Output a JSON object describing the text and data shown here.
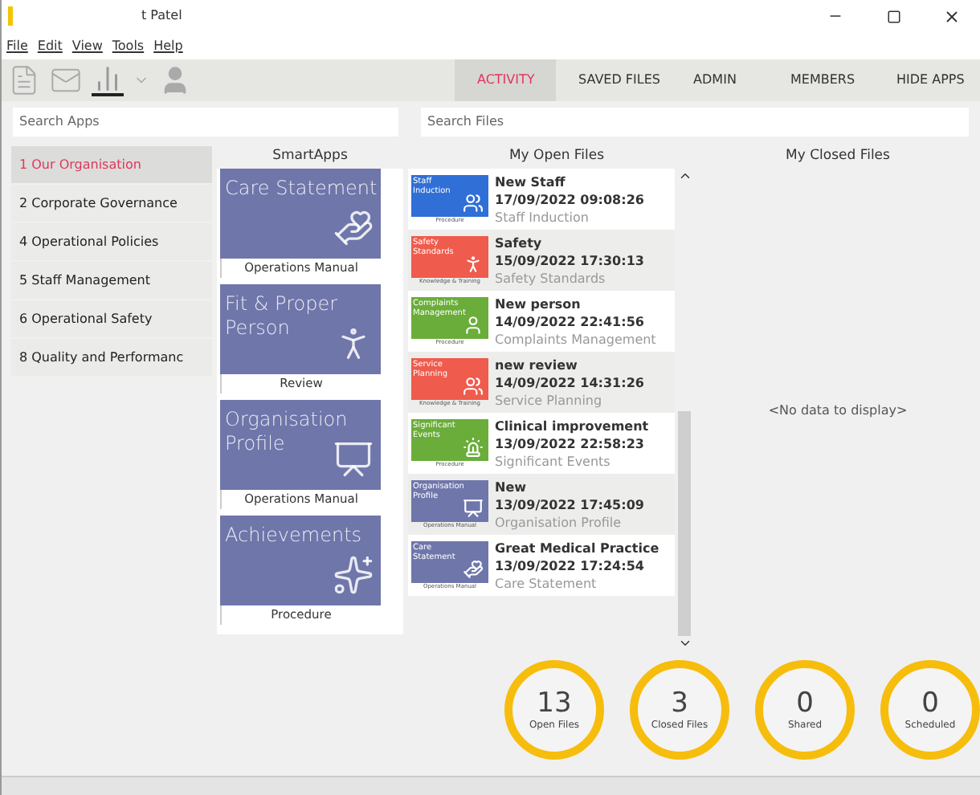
{
  "window": {
    "title": "t Patel"
  },
  "menu": [
    "File",
    "Edit",
    "View",
    "Tools",
    "Help"
  ],
  "tabs": [
    {
      "label": "ACTIVITY",
      "selected": true
    },
    {
      "label": "SAVED FILES",
      "selected": false
    },
    {
      "label": "ADMIN",
      "selected": false
    },
    {
      "label": "MEMBERS",
      "selected": false
    },
    {
      "label": "HIDE APPS",
      "selected": false
    }
  ],
  "search_apps": {
    "placeholder": "Search Apps"
  },
  "search_files": {
    "placeholder": "Search Files"
  },
  "sidebar": {
    "items": [
      {
        "label": "1 Our Organisation",
        "selected": true
      },
      {
        "label": "2 Corporate Governance",
        "selected": false
      },
      {
        "label": "4 Operational Policies",
        "selected": false
      },
      {
        "label": "5 Staff Management",
        "selected": false
      },
      {
        "label": "6 Operational Safety",
        "selected": false
      },
      {
        "label": "8 Quality and Performanc",
        "selected": false
      }
    ]
  },
  "smartapps": {
    "title": "SmartApps",
    "apps": [
      {
        "name": "Care Statement",
        "caption": "Operations Manual"
      },
      {
        "name": "Fit & Proper Person",
        "caption": "Review"
      },
      {
        "name": "Organisation Profile",
        "caption": "Operations Manual"
      },
      {
        "name": "Achievements",
        "caption": "Procedure"
      }
    ]
  },
  "open_files": {
    "title": "My Open Files",
    "files": [
      {
        "tile": "Staff Induction",
        "tile_caption": "Procedure",
        "color": "#2f6fd6",
        "name": "New Staff",
        "date": "17/09/2022 09:08:26",
        "app": "Staff Induction"
      },
      {
        "tile": "Safety Standards",
        "tile_caption": "Knowledge & Training",
        "color": "#ef5b4c",
        "name": "Safety",
        "date": "15/09/2022 17:30:13",
        "app": "Safety Standards"
      },
      {
        "tile": "Complaints Management",
        "tile_caption": "Procedure",
        "color": "#6aad3a",
        "name": "New person",
        "date": "14/09/2022 22:41:56",
        "app": "Complaints Management"
      },
      {
        "tile": "Service Planning",
        "tile_caption": "Knowledge & Training",
        "color": "#ef5b4c",
        "name": "new review",
        "date": "14/09/2022 14:31:26",
        "app": "Service Planning"
      },
      {
        "tile": "Significant Events",
        "tile_caption": "Procedure",
        "color": "#6aad3a",
        "name": "Clinical improvement",
        "date": "13/09/2022 22:58:23",
        "app": "Significant Events"
      },
      {
        "tile": "Organisation Profile",
        "tile_caption": "Operations Manual",
        "color": "#6f76aa",
        "name": "New",
        "date": "13/09/2022 17:45:09",
        "app": "Organisation Profile"
      },
      {
        "tile": "Care Statement",
        "tile_caption": "Operations Manual",
        "color": "#6f76aa",
        "name": "Great Medical Practice",
        "date": "13/09/2022 17:24:54",
        "app": "Care Statement"
      }
    ]
  },
  "closed_files": {
    "title": "My Closed Files",
    "empty": "<No data to display>"
  },
  "stats": [
    {
      "value": "13",
      "label": "Open Files"
    },
    {
      "value": "3",
      "label": "Closed Files"
    },
    {
      "value": "0",
      "label": "Shared"
    },
    {
      "value": "0",
      "label": "Scheduled"
    }
  ]
}
